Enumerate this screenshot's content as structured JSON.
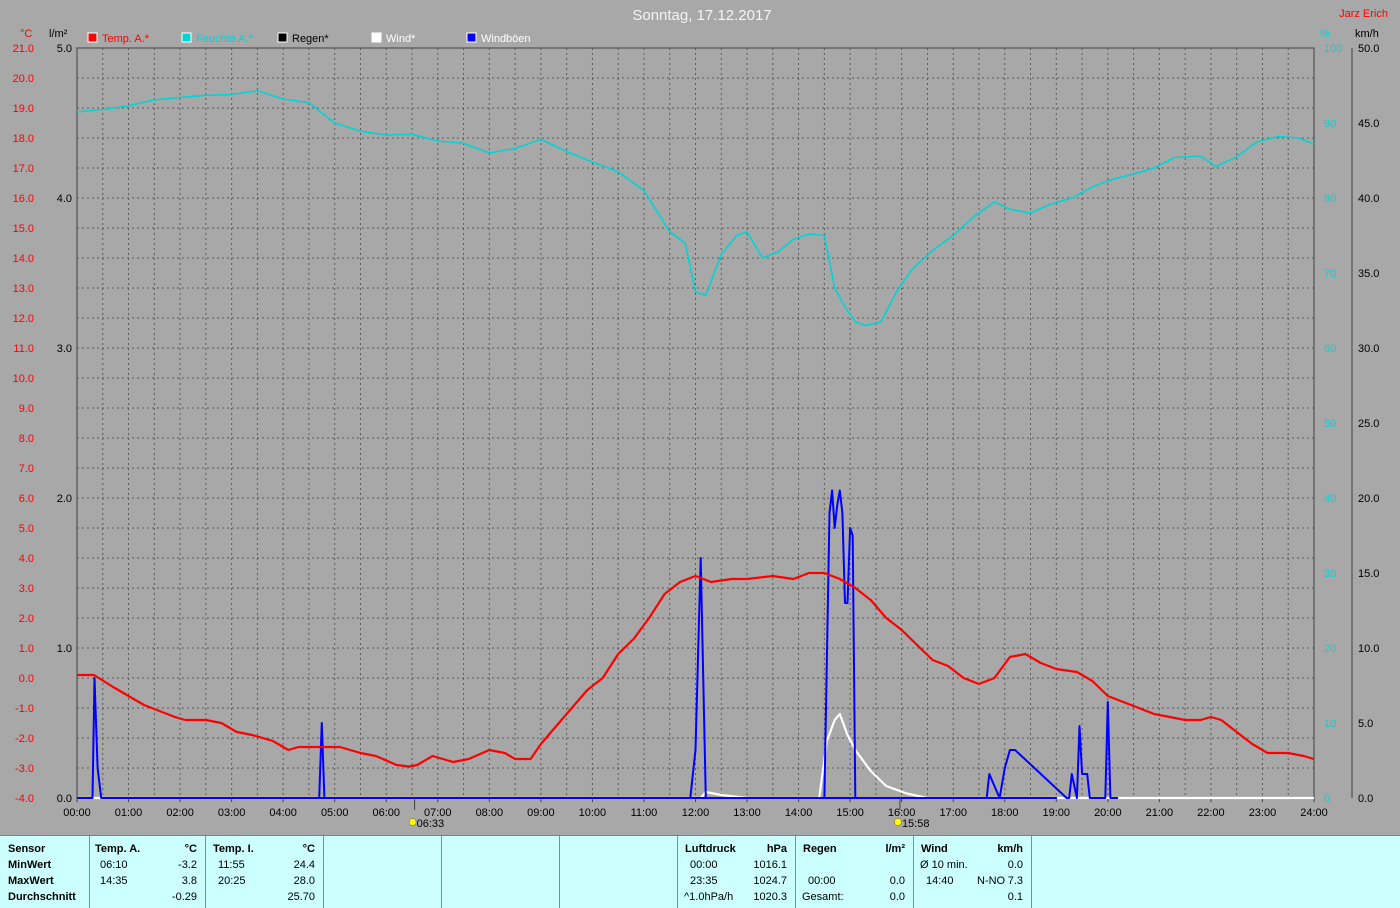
{
  "title": "Sonntag, 17.12.2017",
  "station": "Jarz Erich",
  "colors": {
    "background": "#a8a8a8",
    "grid": "#5a5a5a",
    "temp": "#ff0000",
    "humidity": "#00d4d4",
    "rain": "#000000",
    "wind": "#ffffff",
    "gusts": "#0000ff",
    "panel": "#ccffff"
  },
  "chart_data": {
    "type": "line",
    "title": "Sonntag, 17.12.2017",
    "x_unit": "hours",
    "x_ticks": [
      "00:00",
      "01:00",
      "02:00",
      "03:00",
      "04:00",
      "05:00",
      "06:00",
      "07:00",
      "08:00",
      "09:00",
      "10:00",
      "11:00",
      "12:00",
      "13:00",
      "14:00",
      "15:00",
      "16:00",
      "17:00",
      "18:00",
      "19:00",
      "20:00",
      "21:00",
      "22:00",
      "23:00",
      "24:00"
    ],
    "sunrise": "06:33",
    "sunset": "15:58",
    "axes": {
      "temp": {
        "unit": "°C",
        "range": [
          -4,
          21
        ],
        "ticks": [
          "-4.0",
          "-3.0",
          "-2.0",
          "-1.0",
          "0.0",
          "1.0",
          "2.0",
          "3.0",
          "4.0",
          "5.0",
          "6.0",
          "7.0",
          "8.0",
          "9.0",
          "10.0",
          "11.0",
          "12.0",
          "13.0",
          "14.0",
          "15.0",
          "16.0",
          "17.0",
          "18.0",
          "19.0",
          "20.0",
          "21.0"
        ]
      },
      "rain": {
        "unit": "l/m²",
        "range": [
          0,
          5
        ],
        "ticks": [
          "0.0",
          "1.0",
          "2.0",
          "3.0",
          "4.0",
          "5.0"
        ]
      },
      "humidity": {
        "unit": "%",
        "range": [
          0,
          100
        ],
        "ticks": [
          "0",
          "10",
          "20",
          "30",
          "40",
          "50",
          "60",
          "70",
          "80",
          "90",
          "100"
        ]
      },
      "wind": {
        "unit": "km/h",
        "range": [
          0,
          50
        ],
        "ticks": [
          "0.0",
          "5.0",
          "10.0",
          "15.0",
          "20.0",
          "25.0",
          "30.0",
          "35.0",
          "40.0",
          "45.0",
          "50.0"
        ]
      }
    },
    "grid": true,
    "legend_position": "top",
    "series": [
      {
        "name": "Temp. A.*",
        "axis": "temp",
        "x": [
          0,
          0.33,
          0.7,
          1.0,
          1.3,
          1.6,
          1.9,
          2.1,
          2.5,
          2.8,
          3.1,
          3.4,
          3.8,
          4.1,
          4.3,
          4.7,
          5.1,
          5.5,
          5.8,
          6.2,
          6.45,
          6.6,
          6.9,
          7.3,
          7.6,
          8.0,
          8.3,
          8.5,
          8.8,
          9.0,
          9.3,
          9.6,
          9.9,
          10.2,
          10.5,
          10.8,
          11.1,
          11.4,
          11.7,
          12.0,
          12.3,
          12.7,
          13.0,
          13.5,
          13.9,
          14.2,
          14.5,
          14.8,
          15.1,
          15.4,
          15.7,
          16.0,
          16.3,
          16.6,
          16.9,
          17.2,
          17.5,
          17.8,
          18.1,
          18.4,
          18.7,
          19.0,
          19.4,
          19.7,
          20.0,
          20.3,
          20.6,
          20.9,
          21.2,
          21.5,
          21.8,
          22.0,
          22.2,
          22.5,
          22.8,
          23.1,
          23.5,
          23.8,
          24.0
        ],
        "values": [
          0.1,
          0.1,
          -0.3,
          -0.6,
          -0.9,
          -1.1,
          -1.3,
          -1.4,
          -1.4,
          -1.5,
          -1.8,
          -1.9,
          -2.1,
          -2.4,
          -2.3,
          -2.3,
          -2.3,
          -2.5,
          -2.6,
          -2.9,
          -2.95,
          -2.9,
          -2.6,
          -2.8,
          -2.7,
          -2.4,
          -2.5,
          -2.7,
          -2.7,
          -2.2,
          -1.6,
          -1.0,
          -0.4,
          0.0,
          0.8,
          1.3,
          2.0,
          2.8,
          3.2,
          3.4,
          3.2,
          3.3,
          3.3,
          3.4,
          3.3,
          3.5,
          3.5,
          3.3,
          3.0,
          2.6,
          2.0,
          1.6,
          1.1,
          0.6,
          0.4,
          0.0,
          -0.2,
          0.0,
          0.7,
          0.8,
          0.5,
          0.3,
          0.2,
          -0.1,
          -0.6,
          -0.8,
          -1.0,
          -1.2,
          -1.3,
          -1.4,
          -1.4,
          -1.3,
          -1.4,
          -1.8,
          -2.2,
          -2.5,
          -2.5,
          -2.6,
          -2.7
        ]
      },
      {
        "name": "Feuchte A.*",
        "axis": "humidity",
        "x": [
          0,
          0.5,
          1.0,
          1.5,
          2.0,
          2.5,
          3.0,
          3.5,
          4.0,
          4.5,
          5.0,
          5.5,
          6.0,
          6.5,
          7.0,
          7.5,
          8.0,
          8.5,
          9.0,
          9.5,
          10.0,
          10.5,
          11.0,
          11.5,
          11.8,
          12.0,
          12.2,
          12.5,
          12.8,
          13.0,
          13.3,
          13.6,
          13.9,
          14.2,
          14.5,
          14.7,
          14.9,
          15.1,
          15.3,
          15.6,
          15.9,
          16.2,
          16.6,
          17.0,
          17.4,
          17.8,
          18.1,
          18.5,
          18.9,
          19.3,
          19.7,
          20.1,
          20.5,
          20.9,
          21.3,
          21.8,
          22.1,
          22.5,
          22.9,
          23.3,
          23.7,
          24.0
        ],
        "values": [
          91.5,
          91.8,
          92.3,
          93.1,
          93.4,
          93.7,
          93.8,
          94.3,
          93.2,
          92.7,
          90.0,
          88.9,
          88.4,
          88.5,
          87.6,
          87.3,
          86.0,
          86.6,
          87.8,
          86.2,
          84.8,
          83.5,
          81.0,
          75.5,
          74.0,
          67.5,
          67.0,
          72.5,
          75.0,
          75.5,
          72.0,
          72.8,
          74.5,
          75.2,
          75.0,
          68.0,
          65.5,
          63.5,
          63.0,
          63.5,
          67.5,
          70.5,
          73.0,
          75.0,
          77.5,
          79.5,
          78.5,
          78.0,
          79.2,
          80.0,
          81.5,
          82.5,
          83.2,
          84.0,
          85.4,
          85.6,
          84.2,
          85.5,
          87.5,
          88.2,
          88.0,
          87.2
        ]
      },
      {
        "name": "Regen*",
        "axis": "rain",
        "x": [
          0,
          24
        ],
        "values": [
          0,
          0
        ]
      },
      {
        "name": "Wind*",
        "axis": "wind",
        "x": [
          0,
          12.1,
          12.2,
          12.5,
          13.0,
          14.4,
          14.55,
          14.7,
          14.8,
          14.95,
          15.1,
          15.4,
          15.7,
          16.1,
          16.5,
          24.0
        ],
        "values": [
          0,
          0,
          0.4,
          0.2,
          0,
          0,
          3.8,
          5.2,
          5.6,
          4.2,
          3.2,
          1.8,
          0.8,
          0.3,
          0,
          0
        ]
      },
      {
        "name": "Windböen",
        "axis": "wind",
        "x": [
          0,
          0.3,
          0.34,
          0.4,
          0.47,
          19.0,
          4.6,
          4.7,
          4.75,
          4.8,
          4.85,
          12.0,
          11.9,
          12.0,
          12.1,
          12.2,
          12.3,
          14.45,
          14.5,
          14.6,
          14.65,
          14.7,
          14.75,
          14.8,
          14.85,
          14.9,
          14.95,
          15.0,
          15.05,
          15.1,
          15.15,
          15.2,
          17.6,
          17.65,
          17.7,
          17.9,
          18.0,
          18.1,
          18.2,
          19.2,
          19.25,
          19.3,
          19.4,
          19.45,
          19.5,
          19.6,
          19.65,
          19.7,
          19.95,
          20.0,
          20.05,
          20.1,
          20.2
        ],
        "values": [
          0,
          0,
          8.0,
          2.0,
          0,
          0,
          0,
          0,
          5.0,
          0,
          0,
          0,
          0,
          3.2,
          16.0,
          0,
          0,
          0,
          0,
          19.0,
          20.5,
          18.0,
          19.5,
          20.5,
          19.0,
          13.0,
          13.0,
          18.0,
          17.5,
          0,
          0,
          0,
          0,
          0,
          1.6,
          0,
          2.0,
          3.2,
          3.2,
          0,
          0,
          1.6,
          0,
          4.8,
          1.6,
          1.6,
          0,
          0,
          0,
          6.4,
          0,
          0,
          0
        ]
      }
    ]
  },
  "panel": {
    "sensor": {
      "header": "Sensor",
      "min": "MinWert",
      "max": "MaxWert",
      "avg": "Durchschnitt"
    },
    "temp_a": {
      "header": "Temp. A.",
      "unit": "°C",
      "min_time": "06:10",
      "min_val": "-3.2",
      "max_time": "14:35",
      "max_val": "3.8",
      "avg": "-0.29"
    },
    "temp_i": {
      "header": "Temp. I.",
      "unit": "°C",
      "min_time": "11:55",
      "min_val": "24.4",
      "max_time": "20:25",
      "max_val": "28.0",
      "avg": "25.70"
    },
    "pressure": {
      "header": "Luftdruck",
      "unit": "hPa",
      "row1_time": "00:00",
      "row1_val": "1016.1",
      "row2_time": "23:35",
      "row2_val": "1024.7",
      "row3_label": "^1.0hPa/h",
      "row3_val": "1020.3"
    },
    "rain": {
      "header": "Regen",
      "unit": "l/m²",
      "row2_time": "00:00",
      "row2_val": "0.0",
      "row3_label": "Gesamt:",
      "row3_val": "0.0"
    },
    "wind": {
      "header": "Wind",
      "unit": "km/h",
      "row1_label": "Ø 10 min.",
      "row1_val": "0.0",
      "row2_time": "14:40",
      "row2_dir": "N-NO",
      "row2_val": "7.3",
      "row3_val": "0.1"
    }
  }
}
